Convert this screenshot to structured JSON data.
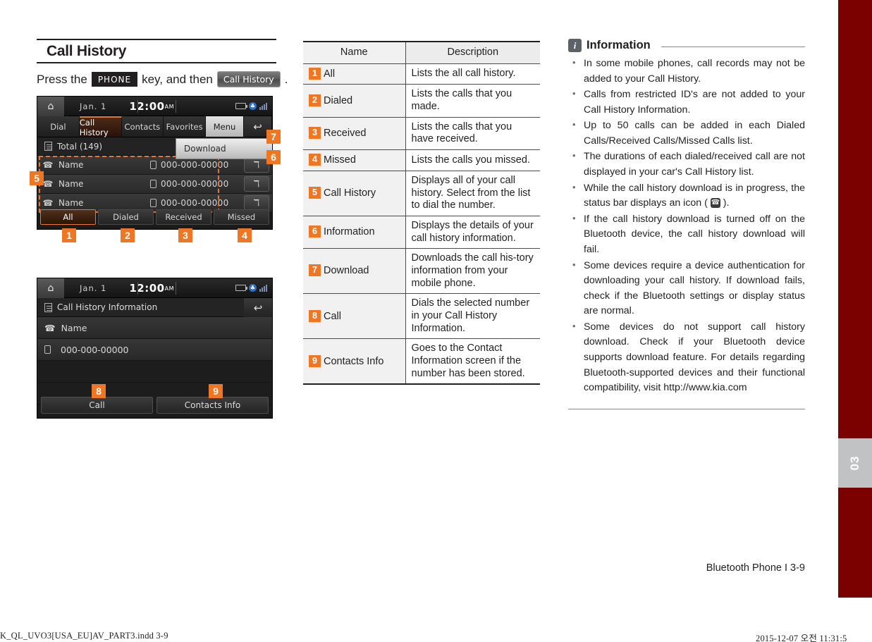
{
  "section": {
    "title": "Call History",
    "press_prefix": "Press the",
    "phone_key": "PHONE",
    "press_middle": "key, and then",
    "call_history_button": "Call History",
    "press_suffix": "."
  },
  "screenshot1": {
    "status": {
      "date": "Jan.  1",
      "time": "12:00",
      "ampm": "AM"
    },
    "nav": [
      "Dial",
      "Call History",
      "Contacts",
      "Favorites",
      "Menu"
    ],
    "active_nav": "Call History",
    "back_icon": "back-arrow-icon",
    "total_label": "Total (149)",
    "download_popup": "Download",
    "rows": [
      {
        "name": "Name",
        "number": "000-000-00000",
        "info": "info-icon"
      },
      {
        "name": "Name",
        "number": "000-000-00000",
        "info": "info-icon"
      },
      {
        "name": "Name",
        "number": "000-000-00000",
        "info": "info-icon"
      }
    ],
    "bottom_tabs": [
      "All",
      "Dialed",
      "Received",
      "Missed"
    ],
    "selected_tab": "All",
    "callouts": [
      "1",
      "2",
      "3",
      "4",
      "5",
      "6",
      "7"
    ]
  },
  "screenshot2": {
    "status": {
      "date": "Jan.  1",
      "time": "12:00",
      "ampm": "AM"
    },
    "header": "Call History Information",
    "name_row": "Name",
    "number_row": "000-000-00000",
    "buttons": [
      "Call",
      "Contacts Info"
    ],
    "callouts": [
      "8",
      "9"
    ]
  },
  "table": {
    "headers": [
      "Name",
      "Description"
    ],
    "rows": [
      {
        "num": "1",
        "name": "All",
        "desc": "Lists the all call history."
      },
      {
        "num": "2",
        "name": "Dialed",
        "desc": "Lists the calls that you made."
      },
      {
        "num": "3",
        "name": "Received",
        "desc": "Lists the calls that you have received."
      },
      {
        "num": "4",
        "name": "Missed",
        "desc": "Lists the calls you missed."
      },
      {
        "num": "5",
        "name": "Call History",
        "desc": "Displays all of your call history. Select from the list to dial the number."
      },
      {
        "num": "6",
        "name": "Information",
        "desc": "Displays the details of your call history information."
      },
      {
        "num": "7",
        "name": "Download",
        "desc": "Downloads the call his-tory information from your mobile phone."
      },
      {
        "num": "8",
        "name": "Call",
        "desc": "Dials the selected number in your Call History Information."
      },
      {
        "num": "9",
        "name": "Contacts Info",
        "desc": "Goes to the Contact Information screen if the number has been stored."
      }
    ]
  },
  "information": {
    "title": "Information",
    "icon": "info-icon",
    "bullets": [
      {
        "pre": "In some mobile phones, call records may not be added to your Call History.",
        "icon": false,
        "post": ""
      },
      {
        "pre": "Calls from restricted ID's are not added to your Call History Information.",
        "icon": false,
        "post": ""
      },
      {
        "pre": "Up to 50 calls can be added in each Dialed Calls/Received Calls/Missed Calls list.",
        "icon": false,
        "post": ""
      },
      {
        "pre": "The durations of each dialed/received call are not displayed in your car's Call History list.",
        "icon": false,
        "post": ""
      },
      {
        "pre": "While the call history download is in progress, the status bar displays an icon ( ",
        "icon": true,
        "post": " )."
      },
      {
        "pre": "If the call history download is turned off on the Bluetooth device, the call history download will fail.",
        "icon": false,
        "post": ""
      },
      {
        "pre": "Some devices require a device authentication for downloading your call history. If download fails, check if the Bluetooth settings or display status are normal.",
        "icon": false,
        "post": ""
      },
      {
        "pre": "Some devices do not support call history download. Check if your Bluetooth device supports download feature. For details regarding Bluetooth-supported devices and their functional compatibility, visit http://www.kia.com",
        "icon": false,
        "post": ""
      }
    ]
  },
  "footer": {
    "page_label": "Bluetooth Phone I 3-9",
    "print_left": "K_QL_UVO3[USA_EU]AV_PART3.indd   3-9",
    "print_right": "2015-12-07   오전 11:31:5",
    "tab_number": "03"
  }
}
